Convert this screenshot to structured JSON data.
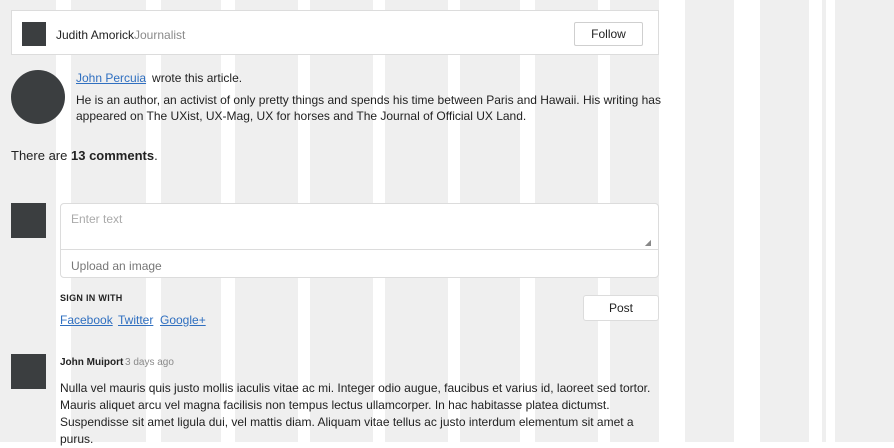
{
  "author_bar": {
    "name": "Judith Amorick",
    "role": "Journalist",
    "follow_label": "Follow"
  },
  "bio": {
    "link_name": "John Percuia",
    "suffix": "wrote this article.",
    "text": "He is an author, an activist of only pretty things and spends his time between Paris and Hawaii. His writing has appeared on The UXist, UX-Mag, UX for horses and The Journal of Official UX Land."
  },
  "comments_summary": {
    "prefix": "There are",
    "count": "13 comments",
    "suffix": "."
  },
  "composer": {
    "placeholder": "Enter text",
    "upload_label": "Upload an image",
    "signin_label": "SIGN IN WITH",
    "providers": [
      "Facebook",
      "Twitter",
      "Google+"
    ],
    "post_label": "Post"
  },
  "comments": [
    {
      "author": "John Muiport",
      "time": "3 days ago",
      "body": "Nulla vel mauris quis justo mollis iaculis vitae ac mi. Integer odio augue, faucibus et varius id, laoreet sed tortor. Mauris aliquet arcu vel magna facilisis non tempus lectus ullamcorper. In hac habitasse platea dictumst. Suspendisse sit amet ligula dui, vel mattis diam. Aliquam vitae tellus ac justo interdum elementum sit amet a purus."
    }
  ],
  "colors": {
    "grid_column": "#efefef",
    "avatar": "#3b3e40",
    "link": "#2f6fc0"
  }
}
